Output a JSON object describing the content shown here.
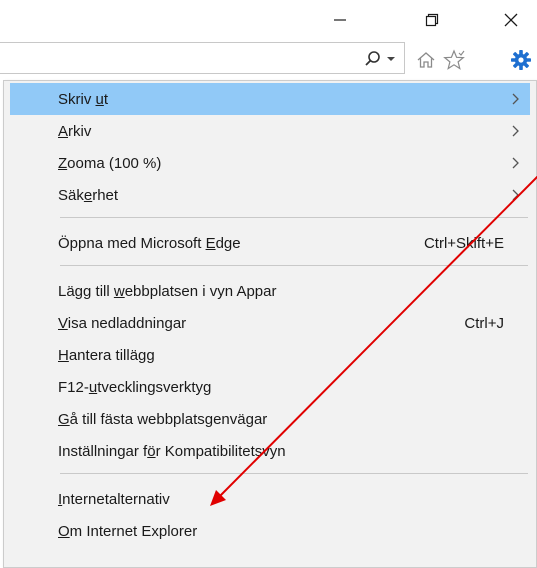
{
  "window": {
    "minimize_icon": "minimize-icon",
    "restore_icon": "restore-icon",
    "close_icon": "close-icon"
  },
  "toolbar": {
    "address_value": "",
    "search_icon": "search-icon",
    "dropdown_icon": "chevron-down-icon",
    "home_icon": "home-icon",
    "favorites_icon": "star-icon",
    "settings_icon": "gear-icon",
    "settings_color": "#1e6fd0"
  },
  "menu": {
    "highlight_color": "#91c9f7",
    "items": [
      {
        "pre": "Skriv ",
        "acc": "u",
        "post": "t",
        "shortcut": "",
        "submenu": true,
        "highlighted": true
      },
      {
        "pre": "",
        "acc": "A",
        "post": "rkiv",
        "shortcut": "",
        "submenu": true,
        "highlighted": false
      },
      {
        "pre": "",
        "acc": "Z",
        "post": "ooma (100 %)",
        "shortcut": "",
        "submenu": true,
        "highlighted": false
      },
      {
        "pre": "Säk",
        "acc": "e",
        "post": "rhet",
        "shortcut": "",
        "submenu": true,
        "highlighted": false
      },
      {
        "pre": "Öppna med Microsoft ",
        "acc": "E",
        "post": "dge",
        "shortcut": "Ctrl+Skift+E",
        "submenu": false,
        "highlighted": false
      },
      {
        "pre": "Lägg till ",
        "acc": "w",
        "post": "ebbplatsen i vyn Appar",
        "shortcut": "",
        "submenu": false,
        "highlighted": false
      },
      {
        "pre": "",
        "acc": "V",
        "post": "isa nedladdningar",
        "shortcut": "Ctrl+J",
        "submenu": false,
        "highlighted": false
      },
      {
        "pre": "",
        "acc": "H",
        "post": "antera tillägg",
        "shortcut": "",
        "submenu": false,
        "highlighted": false
      },
      {
        "pre": "F12-",
        "acc": "u",
        "post": "tvecklingsverktyg",
        "shortcut": "",
        "submenu": false,
        "highlighted": false
      },
      {
        "pre": "",
        "acc": "G",
        "post": "å till fästa webbplatsgenvägar",
        "shortcut": "",
        "submenu": false,
        "highlighted": false
      },
      {
        "pre": "Inställningar f",
        "acc": "ö",
        "post": "r Kompatibilitetsvyn",
        "shortcut": "",
        "submenu": false,
        "highlighted": false
      },
      {
        "pre": "",
        "acc": "I",
        "post": "nternetalternativ",
        "shortcut": "",
        "submenu": false,
        "highlighted": false
      },
      {
        "pre": "",
        "acc": "O",
        "post": "m Internet Explorer",
        "shortcut": "",
        "submenu": false,
        "highlighted": false
      }
    ]
  },
  "annotation": {
    "arrow_color": "#e00000"
  }
}
